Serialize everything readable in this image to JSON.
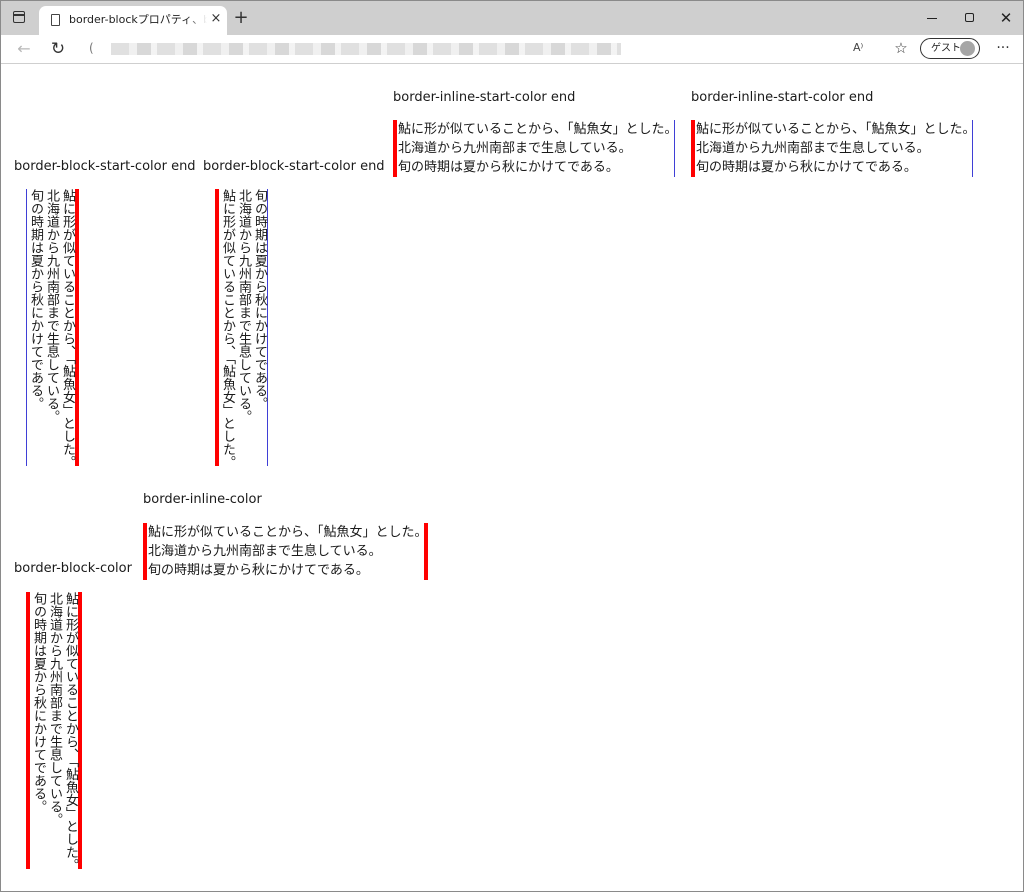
{
  "browser": {
    "tab_title": "border-blockプロパティ、border-inline",
    "tab_close": "×",
    "new_tab": "+",
    "address_info": "(",
    "read_aloud": "A⁾",
    "profile_label": "ゲスト",
    "menu": "···",
    "min": "",
    "close": "✕"
  },
  "colors": {
    "border_red": "#ff0000",
    "border_blue": "#3f3fd6"
  },
  "samples": [
    {
      "caption": "border-block-start-color end",
      "lines": [
        "鮎に形が似ていることから、「鮎魚女」とした。",
        "北海道から九州南部まで生息している。",
        "旬の時期は夏から秋にかけてである。"
      ]
    },
    {
      "caption": "border-block-start-color end",
      "lines": [
        "鮎に形が似ていることから、「鮎魚女」とした。",
        "北海道から九州南部まで生息している。",
        "旬の時期は夏から秋にかけてである。"
      ]
    },
    {
      "caption": "border-inline-start-color end",
      "lines": [
        "鮎に形が似ていることから、「鮎魚女」とした。",
        "北海道から九州南部まで生息している。",
        "旬の時期は夏から秋にかけてである。"
      ]
    },
    {
      "caption": "border-inline-start-color end",
      "lines": [
        "鮎に形が似ていることから、「鮎魚女」とした。",
        "北海道から九州南部まで生息している。",
        "旬の時期は夏から秋にかけてである。"
      ]
    },
    {
      "caption": "border-block-color",
      "lines": [
        "鮎に形が似ていることから、「鮎魚女」とした。",
        "北海道から九州南部まで生息している。",
        "旬の時期は夏から秋にかけてである。"
      ]
    },
    {
      "caption": "border-inline-color",
      "lines": [
        "鮎に形が似ていることから、「鮎魚女」とした。",
        "北海道から九州南部まで生息している。",
        "旬の時期は夏から秋にかけてである。"
      ]
    }
  ]
}
